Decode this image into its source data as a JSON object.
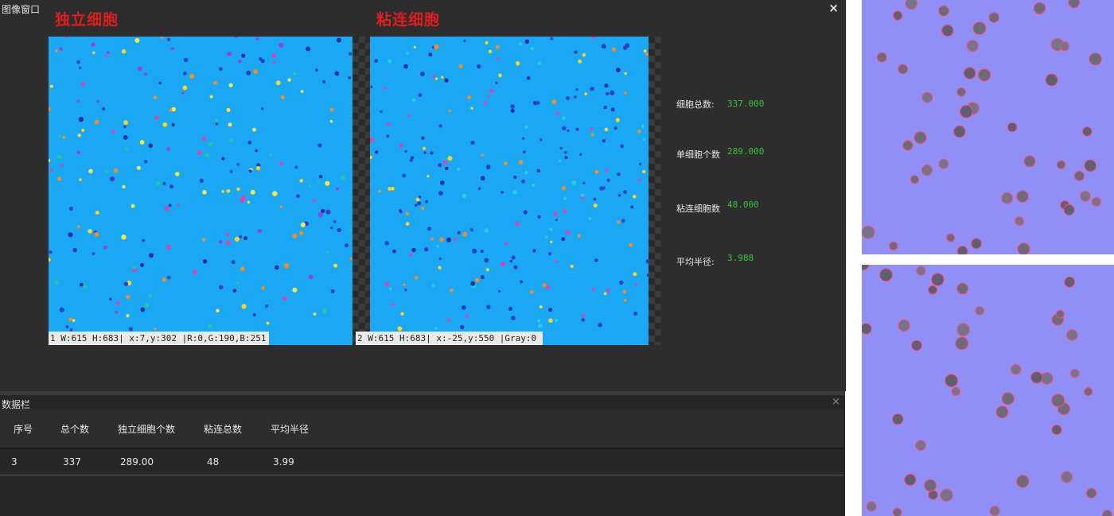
{
  "image_window": {
    "title": "图像窗口",
    "close_label": "×",
    "left_panel": {
      "title": "独立细胞",
      "status": "1  W:615 H:683| x:7,y:302 |R:0,G:190,B:251"
    },
    "right_panel": {
      "title": "粘连细胞",
      "status": "2  W:615 H:683| x:-25,y:550 |Gray:0"
    }
  },
  "stats": [
    {
      "label": "细胞总数:",
      "value": "337.000"
    },
    {
      "label": "单细胞个数",
      "value": "289.000"
    },
    {
      "label": "粘连细胞数",
      "value": "48.000"
    },
    {
      "label": "平均半径:",
      "value": "3.988"
    }
  ],
  "data_panel": {
    "title": "数据栏",
    "close_label": "×",
    "columns": [
      "序号",
      "总个数",
      "独立细胞个数",
      "粘连总数",
      "平均半径"
    ],
    "rows": [
      [
        "3",
        "337",
        "289.00",
        "48",
        "3.99"
      ]
    ]
  },
  "colors": {
    "background": "#2b2b2b",
    "panel_title": "#e21d1d",
    "stat_value": "#35c435",
    "analysis_image": "#1aa8f5",
    "micrograph": "#8f8ff5"
  }
}
